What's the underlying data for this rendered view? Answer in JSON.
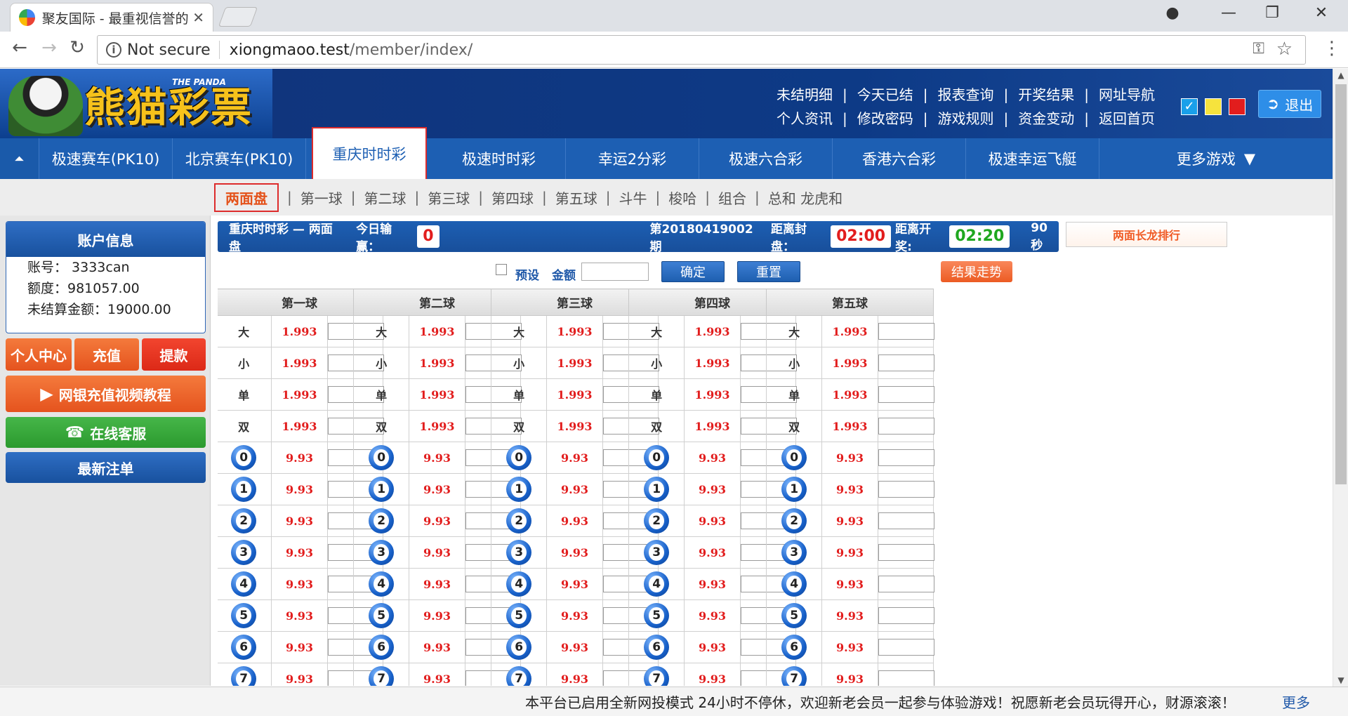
{
  "browser": {
    "tab_title": "聚友国际 - 最重视信誉的",
    "tab_close": "✕",
    "not_secure": "Not secure",
    "url_host": "xiongmaoo.test",
    "url_path": "/member/index/",
    "window_controls": [
      "profile-icon",
      "minimize-icon",
      "restore-icon",
      "close-icon"
    ]
  },
  "header": {
    "logo_text": "熊猫彩票",
    "logo_subtext": "THE PANDA",
    "top_links_row1": [
      "未结明细",
      "今天已结",
      "报表查询",
      "开奖结果",
      "网址导航"
    ],
    "top_links_row2": [
      "个人资讯",
      "修改密码",
      "游戏规则",
      "资金变动",
      "返回首页"
    ],
    "theme_colors": [
      "#19a0ea",
      "#f6e33d",
      "#e21d1d"
    ],
    "logout_label": "退出"
  },
  "main_nav": {
    "items": [
      "极速赛车(PK10)",
      "北京赛车(PK10)",
      "重庆时时彩",
      "极速时时彩",
      "幸运2分彩",
      "极速六合彩",
      "香港六合彩",
      "极速幸运飞艇"
    ],
    "active_index": 2,
    "more_label": "更多游戏",
    "more_arrow": "▼",
    "up_arrow": "⏶"
  },
  "sub_nav": {
    "items": [
      "两面盘",
      "第一球",
      "第二球",
      "第三球",
      "第四球",
      "第五球",
      "斗牛",
      "梭哈",
      "组合",
      "总和 龙虎和"
    ],
    "active_index": 0,
    "separator": "|"
  },
  "sidebar": {
    "account_title": "账户信息",
    "account_rows": [
      "账号： 3333can",
      "额度：981057.00",
      "未结算金额：19000.00"
    ],
    "personal_center": "个人中心",
    "recharge": "充值",
    "withdraw": "提款",
    "video_tutorial": "网银充值视频教程",
    "online_service": "在线客服",
    "latest_bets": "最新注单"
  },
  "info_bar": {
    "game_label": "重庆时时彩 — 两面盘",
    "today_pnl_label": "今日输赢：",
    "today_pnl_value": "0",
    "period": "第20180419002期",
    "close_label": "距离封盘：",
    "close_countdown": "02:00",
    "draw_label": "距离开奖:",
    "draw_countdown": "02:20",
    "refresh_seconds": "90秒"
  },
  "long_dragon_label": "两面长龙排行",
  "bet_controls": {
    "preset_label": "预设",
    "amount_label": "金额",
    "confirm_label": "确定",
    "reset_label": "重置",
    "trend_label": "结果走势"
  },
  "odds": {
    "balls": [
      "第一球",
      "第二球",
      "第三球",
      "第四球",
      "第五球"
    ],
    "text_rows": [
      {
        "name": "大",
        "odds": "1.993"
      },
      {
        "name": "小",
        "odds": "1.993"
      },
      {
        "name": "单",
        "odds": "1.993"
      },
      {
        "name": "双",
        "odds": "1.993"
      }
    ],
    "number_rows": [
      {
        "num": "0",
        "odds": "9.93"
      },
      {
        "num": "1",
        "odds": "9.93"
      },
      {
        "num": "2",
        "odds": "9.93"
      },
      {
        "num": "3",
        "odds": "9.93"
      },
      {
        "num": "4",
        "odds": "9.93"
      },
      {
        "num": "5",
        "odds": "9.93"
      },
      {
        "num": "6",
        "odds": "9.93"
      },
      {
        "num": "7",
        "odds": "9.93"
      }
    ]
  },
  "marquee": {
    "text": "本平台已启用全新网投模式 24小时不停休，欢迎新老会员一起参与体验游戏！祝愿新老会员玩得开心，财源滚滚！",
    "more": "更多"
  }
}
